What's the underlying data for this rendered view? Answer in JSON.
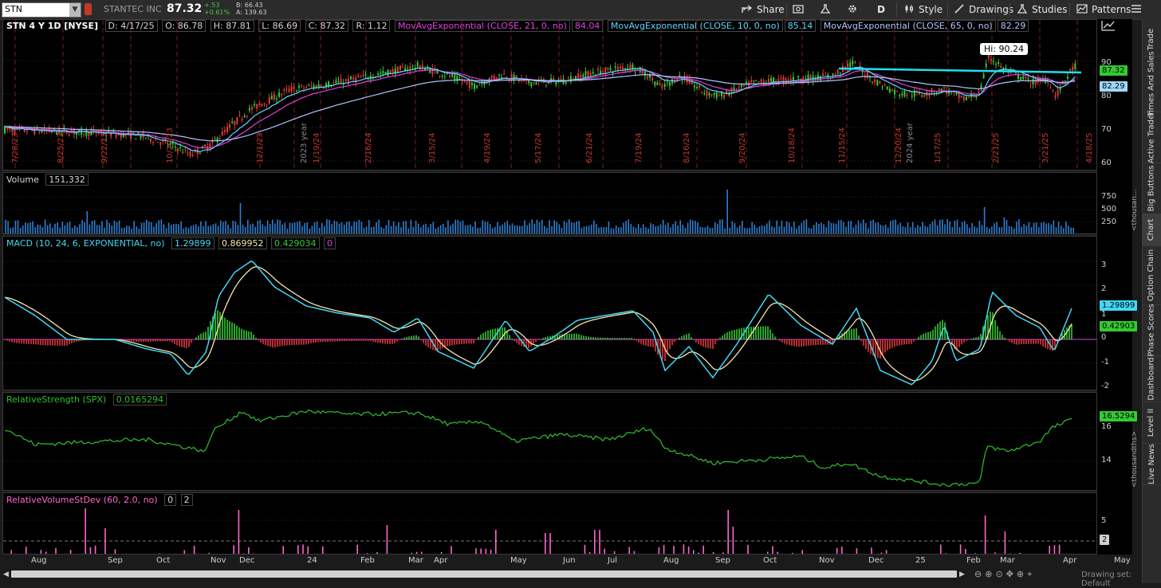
{
  "toolbar": {
    "symbol": "STN",
    "company": "STANTEC INC",
    "last": "87.32",
    "change": "+.53",
    "change_pct": "+0.61%",
    "bid": "B: 66.43",
    "ask": "A: 139.63",
    "share_label": "Share",
    "period_label": "D",
    "style_label": "Style",
    "drawings_label": "Drawings",
    "studies_label": "Studies",
    "patterns_label": "Patterns"
  },
  "price_panel": {
    "title": "STN 4 Y 1D [NYSE]",
    "date": "D: 4/17/25",
    "open": "O: 86.78",
    "high": "H: 87.81",
    "low": "L: 86.69",
    "close": "C: 87.32",
    "range": "R: 1.12",
    "ema21_label": "MovAvgExponential (CLOSE, 21, 0, no)",
    "ema21_value": "84.04",
    "ema10_label": "MovAvgExponential (CLOSE, 10, 0, no)",
    "ema10_value": "85.14",
    "ema65_label": "MovAvgExponential (CLOSE, 65, 0, no)",
    "ema65_value": "82.29",
    "hi_bubble": "Hi: 90.24",
    "last_tag": "87.32",
    "ema65_tag": "82.29",
    "yticks": [
      "90",
      "80",
      "70",
      "60"
    ],
    "date_markers": [
      "12/1/23",
      "2023 year",
      "1/19/24",
      "2/16/24",
      "3/15/24",
      "4/19/24",
      "5/17/24",
      "6/21/24",
      "7/19/24",
      "8/16/24",
      "9/20/24",
      "10/18/24",
      "11/15/24",
      "12/20/24",
      "2024 year",
      "1/17/25",
      "2/21/25",
      "3/21/25",
      "4/18/25"
    ],
    "early_markers": [
      "7/28/23",
      "8/25/23",
      "9/22/23",
      "10/20/23"
    ]
  },
  "volume_panel": {
    "title": "Volume",
    "value": "151,332",
    "yticks": [
      "750",
      "500",
      "250"
    ],
    "unit": "<thousan..."
  },
  "macd_panel": {
    "title": "MACD (10, 24, 6, EXPONENTIAL, no)",
    "value": "1.29899",
    "avg": "0.869952",
    "diff": "0.429034",
    "zero": "0",
    "tag_value": "1.29899",
    "tag_diff": "0.42903",
    "yticks": [
      "3",
      "2",
      "1",
      "0",
      "-1",
      "-2"
    ]
  },
  "rs_panel": {
    "title": "RelativeStrength (SPX)",
    "value": "0.0165294",
    "tag": "16.5294",
    "yticks": [
      "16",
      "14"
    ],
    "unit": "<thousandths>"
  },
  "rvsd_panel": {
    "title": "RelativeVolumeStDev (60, 2.0, no)",
    "value": "0",
    "level": "2",
    "yticks": [
      "5",
      "2"
    ]
  },
  "xaxis": [
    "Aug",
    "Sep",
    "Oct",
    "Nov",
    "Dec",
    "24",
    "Feb",
    "Mar",
    "Apr",
    "May",
    "Jun",
    "Jul",
    "Aug",
    "Sep",
    "Oct",
    "Nov",
    "Dec",
    "25",
    "Feb",
    "Mar",
    "Apr",
    "May"
  ],
  "drawing_set": "Drawing set: Default",
  "sidebar_tabs": [
    "Trade",
    "Times And Sales",
    "Active Trader",
    "Big Buttons",
    "Chart",
    "Option Chain",
    "Phase Scores",
    "Dashboard",
    "Level II",
    "Live News"
  ],
  "colors": {
    "up": "#33cc33",
    "down": "#e03a3a",
    "ema21": "#e040e0",
    "ema10": "#5fd7ff",
    "ema65": "#b0c4ff",
    "trend": "#1ee0f0",
    "macd": "#42d7f5",
    "signal": "#f5e6b0",
    "rs": "#2fc12f",
    "rvsd": "#ff66cc"
  }
}
